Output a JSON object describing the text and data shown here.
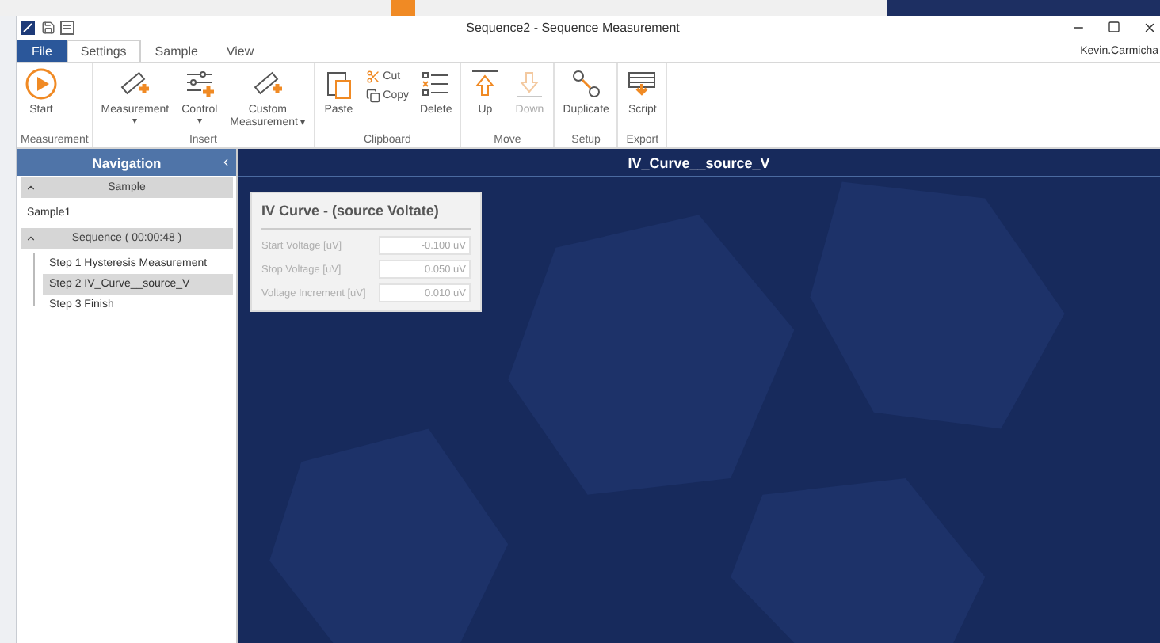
{
  "window": {
    "title": "Sequence2 - Sequence Measurement"
  },
  "tabs": [
    {
      "label": "File",
      "kind": "file",
      "selected": false
    },
    {
      "label": "Settings",
      "kind": "tab",
      "selected": true
    },
    {
      "label": "Sample",
      "kind": "tab",
      "selected": false
    },
    {
      "label": "View",
      "kind": "tab",
      "selected": false
    }
  ],
  "user": "Kevin.Carmicha",
  "ribbon": {
    "groups": [
      {
        "label": "Measurement",
        "buttons": [
          {
            "label": "Start",
            "kind": "large",
            "disabled": false
          }
        ]
      },
      {
        "label": "Insert",
        "buttons": [
          {
            "label": "Measurement",
            "kind": "large",
            "caret": "▾",
            "disabled": false
          },
          {
            "label": "Control",
            "kind": "large",
            "caret": "▾",
            "disabled": false
          },
          {
            "label": "Custom Measurement",
            "kind": "large",
            "caret": "▾",
            "disabled": false
          }
        ]
      },
      {
        "label": "Clipboard",
        "buttons": [
          {
            "label": "Paste",
            "kind": "large",
            "disabled": false
          },
          {
            "label": "Cut",
            "kind": "small",
            "disabled": false
          },
          {
            "label": "Copy",
            "kind": "small",
            "disabled": false
          },
          {
            "label": "Delete",
            "kind": "large",
            "disabled": false
          }
        ]
      },
      {
        "label": "Move",
        "buttons": [
          {
            "label": "Up",
            "kind": "large",
            "disabled": false
          },
          {
            "label": "Down",
            "kind": "large",
            "disabled": true
          }
        ]
      },
      {
        "label": "Setup",
        "buttons": [
          {
            "label": "Duplicate",
            "kind": "large",
            "disabled": false
          }
        ]
      },
      {
        "label": "Export",
        "buttons": [
          {
            "label": "Script",
            "kind": "large",
            "disabled": false
          }
        ]
      }
    ]
  },
  "navigation": {
    "title": "Navigation",
    "sections": [
      {
        "header": "Sample",
        "expanded": true,
        "items": [
          {
            "label": "Sample1",
            "selected": false
          }
        ]
      },
      {
        "header": "Sequence ( 00:00:48 )",
        "expanded": true,
        "items": [
          {
            "label": "Step 1 Hysteresis Measurement",
            "selected": false
          },
          {
            "label": "Step 2 IV_Curve__source_V",
            "selected": true
          },
          {
            "label": "Step 3 Finish",
            "selected": false
          }
        ]
      }
    ]
  },
  "content": {
    "title": "IV_Curve__source_V",
    "card": {
      "title": "IV Curve - (source Voltate)",
      "fields": [
        {
          "label": "Start Voltage [uV]",
          "value": "-0.100 uV",
          "disabled": true
        },
        {
          "label": "Stop Voltage [uV]",
          "value": "0.050 uV",
          "disabled": true
        },
        {
          "label": "Voltage Increment [uV]",
          "value": "0.010 uV",
          "disabled": true
        }
      ]
    }
  }
}
